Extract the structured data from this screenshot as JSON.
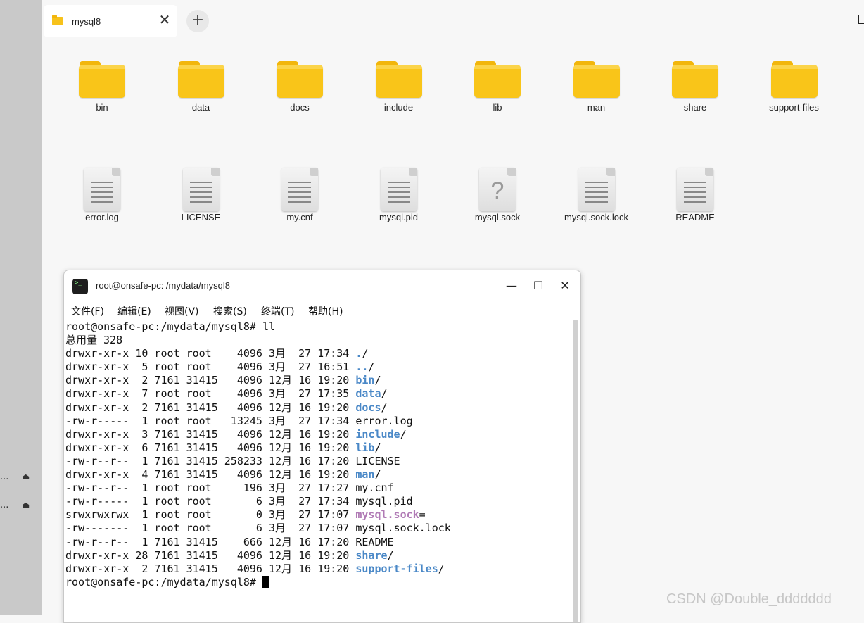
{
  "sidebar": {
    "rows": [
      {
        "dots": "...",
        "eject": "⏏"
      },
      {
        "dots": "...",
        "eject": "⏏"
      }
    ]
  },
  "tab": {
    "label": "mysql8",
    "close": "✕"
  },
  "newtab": {
    "label": "+"
  },
  "folders": [
    {
      "name": "bin"
    },
    {
      "name": "data"
    },
    {
      "name": "docs"
    },
    {
      "name": "include"
    },
    {
      "name": "lib"
    },
    {
      "name": "man"
    },
    {
      "name": "share"
    },
    {
      "name": "support-files"
    }
  ],
  "files": [
    {
      "name": "error.log",
      "icon": "text-file-icon"
    },
    {
      "name": "LICENSE",
      "icon": "text-file-icon"
    },
    {
      "name": "my.cnf",
      "icon": "text-file-icon"
    },
    {
      "name": "mysql.pid",
      "icon": "text-file-icon"
    },
    {
      "name": "mysql.sock",
      "icon": "unknown-file-icon",
      "glyph": "?"
    },
    {
      "name": "mysql.sock.lock",
      "icon": "text-file-icon"
    },
    {
      "name": "README",
      "icon": "text-file-icon"
    }
  ],
  "terminal": {
    "title": "root@onsafe-pc: /mydata/mysql8",
    "icon_text": ">_",
    "controls": {
      "minimize": "—",
      "maximize": "☐",
      "close": "✕"
    },
    "menu": [
      "文件(F)",
      "编辑(E)",
      "视图(V)",
      "搜索(S)",
      "终端(T)",
      "帮助(H)"
    ],
    "lines": [
      {
        "pre": "root@onsafe-pc:/mydata/mysql8# ll",
        "name": "",
        "kind": "",
        "post": ""
      },
      {
        "pre": "总用量 328",
        "name": "",
        "kind": "",
        "post": ""
      },
      {
        "pre": "drwxr-xr-x 10 root root    4096 3月  27 17:34 ",
        "name": ".",
        "kind": "dir",
        "post": "/"
      },
      {
        "pre": "drwxr-xr-x  5 root root    4096 3月  27 16:51 ",
        "name": "..",
        "kind": "dir",
        "post": "/"
      },
      {
        "pre": "drwxr-xr-x  2 7161 31415   4096 12月 16 19:20 ",
        "name": "bin",
        "kind": "dir",
        "post": "/"
      },
      {
        "pre": "drwxr-xr-x  7 root root    4096 3月  27 17:35 ",
        "name": "data",
        "kind": "dir",
        "post": "/"
      },
      {
        "pre": "drwxr-xr-x  2 7161 31415   4096 12月 16 19:20 ",
        "name": "docs",
        "kind": "dir",
        "post": "/"
      },
      {
        "pre": "-rw-r-----  1 root root   13245 3月  27 17:34 error.log",
        "name": "",
        "kind": "",
        "post": ""
      },
      {
        "pre": "drwxr-xr-x  3 7161 31415   4096 12月 16 19:20 ",
        "name": "include",
        "kind": "dir",
        "post": "/"
      },
      {
        "pre": "drwxr-xr-x  6 7161 31415   4096 12月 16 19:20 ",
        "name": "lib",
        "kind": "dir",
        "post": "/"
      },
      {
        "pre": "-rw-r--r--  1 7161 31415 258233 12月 16 17:20 LICENSE",
        "name": "",
        "kind": "",
        "post": ""
      },
      {
        "pre": "drwxr-xr-x  4 7161 31415   4096 12月 16 19:20 ",
        "name": "man",
        "kind": "dir",
        "post": "/"
      },
      {
        "pre": "-rw-r--r--  1 root root     196 3月  27 17:27 my.cnf",
        "name": "",
        "kind": "",
        "post": ""
      },
      {
        "pre": "-rw-r-----  1 root root       6 3月  27 17:34 mysql.pid",
        "name": "",
        "kind": "",
        "post": ""
      },
      {
        "pre": "srwxrwxrwx  1 root root       0 3月  27 17:07 ",
        "name": "mysql.sock",
        "kind": "sock",
        "post": "="
      },
      {
        "pre": "-rw-------  1 root root       6 3月  27 17:07 mysql.sock.lock",
        "name": "",
        "kind": "",
        "post": ""
      },
      {
        "pre": "-rw-r--r--  1 7161 31415    666 12月 16 17:20 README",
        "name": "",
        "kind": "",
        "post": ""
      },
      {
        "pre": "drwxr-xr-x 28 7161 31415   4096 12月 16 19:20 ",
        "name": "share",
        "kind": "dir",
        "post": "/"
      },
      {
        "pre": "drwxr-xr-x  2 7161 31415   4096 12月 16 19:20 ",
        "name": "support-files",
        "kind": "dir",
        "post": "/"
      }
    ],
    "prompt": "root@onsafe-pc:/mydata/mysql8# "
  },
  "watermark": "CSDN @Double_ddddddd"
}
